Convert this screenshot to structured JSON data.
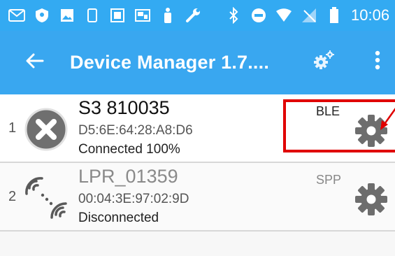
{
  "status_bar": {
    "time": "10:06",
    "icons": [
      "gmail-icon",
      "shield-icon",
      "image-icon",
      "sim-icon",
      "photo-icon",
      "cast-icon",
      "person-icon",
      "wrench-icon",
      "bluetooth-icon",
      "do-not-disturb-icon",
      "wifi-icon",
      "no-signal-icon",
      "battery-icon"
    ]
  },
  "app_bar": {
    "title": "Device Manager 1.7....",
    "back_icon": "back-arrow-icon",
    "settings_icon": "gears-icon",
    "menu_icon": "more-vert-icon"
  },
  "devices": [
    {
      "index": "1",
      "name": "S3 810035",
      "mac": "D5:6E:64:28:A8:D6",
      "status": "Connected 100%",
      "protocol": "BLE",
      "icon": "x-circle-icon",
      "state": "connected"
    },
    {
      "index": "2",
      "name": "LPR_01359",
      "mac": "00:04:3E:97:02:9D",
      "status": "Disconnected",
      "protocol": "SPP",
      "icon": "signal-waves-icon",
      "state": "disconnected"
    }
  ],
  "colors": {
    "accent": "#39a7f0",
    "annotation": "#e00000"
  }
}
